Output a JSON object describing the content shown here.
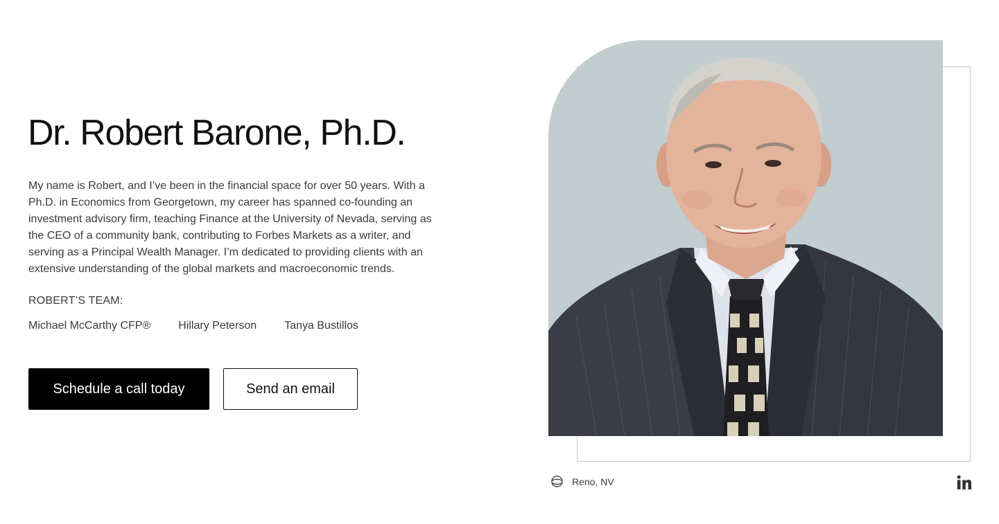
{
  "profile": {
    "name": "Dr. Robert Barone, Ph.D.",
    "bio": "My name is Robert, and I’ve been in the financial space for over 50 years. With a Ph.D. in Economics from Georgetown, my career has spanned co-founding an investment advisory firm, teaching Finance at the University of Nevada, serving as the CEO of a community bank, contributing to Forbes Markets as a writer, and serving as a Principal Wealth Manager. I’m dedicated to providing clients with an extensive understanding of the global markets and macroeconomic trends.",
    "location": "Reno, NV"
  },
  "team": {
    "heading": "ROBERT’S TEAM:",
    "members": [
      "Michael McCarthy CFP®",
      "Hillary Peterson",
      "Tanya Bustillos"
    ]
  },
  "actions": {
    "schedule_label": "Schedule a call today",
    "email_label": "Send an email"
  },
  "icons": {
    "location": "location-pin-icon",
    "social": "linkedin-icon"
  },
  "colors": {
    "primary_button_bg": "#000000",
    "primary_button_text": "#ffffff",
    "photo_background": "#c1cdcf",
    "frame_border": "#cfcbc6",
    "body_text": "#3a3a3a"
  }
}
